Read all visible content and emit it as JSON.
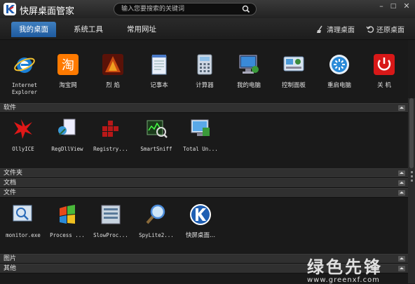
{
  "window": {
    "title": "快屏桌面管家",
    "search_placeholder": "输入您要搜索的关键词",
    "min_label": "–",
    "max_label": "□",
    "close_label": "✕"
  },
  "nav": {
    "tabs": [
      {
        "label": "我的桌面",
        "active": true
      },
      {
        "label": "系统工具",
        "active": false
      },
      {
        "label": "常用网址",
        "active": false
      }
    ],
    "clean_label": "清理桌面",
    "restore_label": "还原桌面"
  },
  "desktop_items": [
    {
      "label": "Internet\nExplorer",
      "icon": "ie-icon"
    },
    {
      "label": "淘宝网",
      "icon": "taobao-icon"
    },
    {
      "label": "烈 焰",
      "icon": "game-icon"
    },
    {
      "label": "记事本",
      "icon": "notepad-icon"
    },
    {
      "label": "计算器",
      "icon": "calculator-icon"
    },
    {
      "label": "我的电脑",
      "icon": "computer-icon"
    },
    {
      "label": "控制面板",
      "icon": "control-panel-icon"
    },
    {
      "label": "重启电脑",
      "icon": "restart-icon"
    },
    {
      "label": "关 机",
      "icon": "shutdown-icon"
    }
  ],
  "sections": [
    {
      "title": "软件",
      "items": [
        {
          "label": "OllyICE",
          "icon": "ollyice-icon"
        },
        {
          "label": "RegDllView",
          "icon": "regdllview-icon"
        },
        {
          "label": "Registry...",
          "icon": "registry-icon"
        },
        {
          "label": "SmartSniff",
          "icon": "smartsniff-icon"
        },
        {
          "label": "Total Un...",
          "icon": "total-uninstall-icon"
        }
      ]
    },
    {
      "title": "文件夹",
      "items": []
    },
    {
      "title": "文档",
      "items": []
    },
    {
      "title": "文件",
      "items": [
        {
          "label": "monitor.exe",
          "icon": "monitor-icon"
        },
        {
          "label": "Process ...",
          "icon": "process-icon"
        },
        {
          "label": "SlowProc...",
          "icon": "slowproc-icon"
        },
        {
          "label": "SpyLite2...",
          "icon": "spylite-icon"
        },
        {
          "label": "快屏桌面...",
          "icon": "kuaiping-icon"
        }
      ]
    },
    {
      "title": "图片",
      "items": []
    },
    {
      "title": "其他",
      "items": []
    }
  ],
  "watermark": {
    "text": "绿色先锋",
    "url": "www.greenxf.com"
  }
}
